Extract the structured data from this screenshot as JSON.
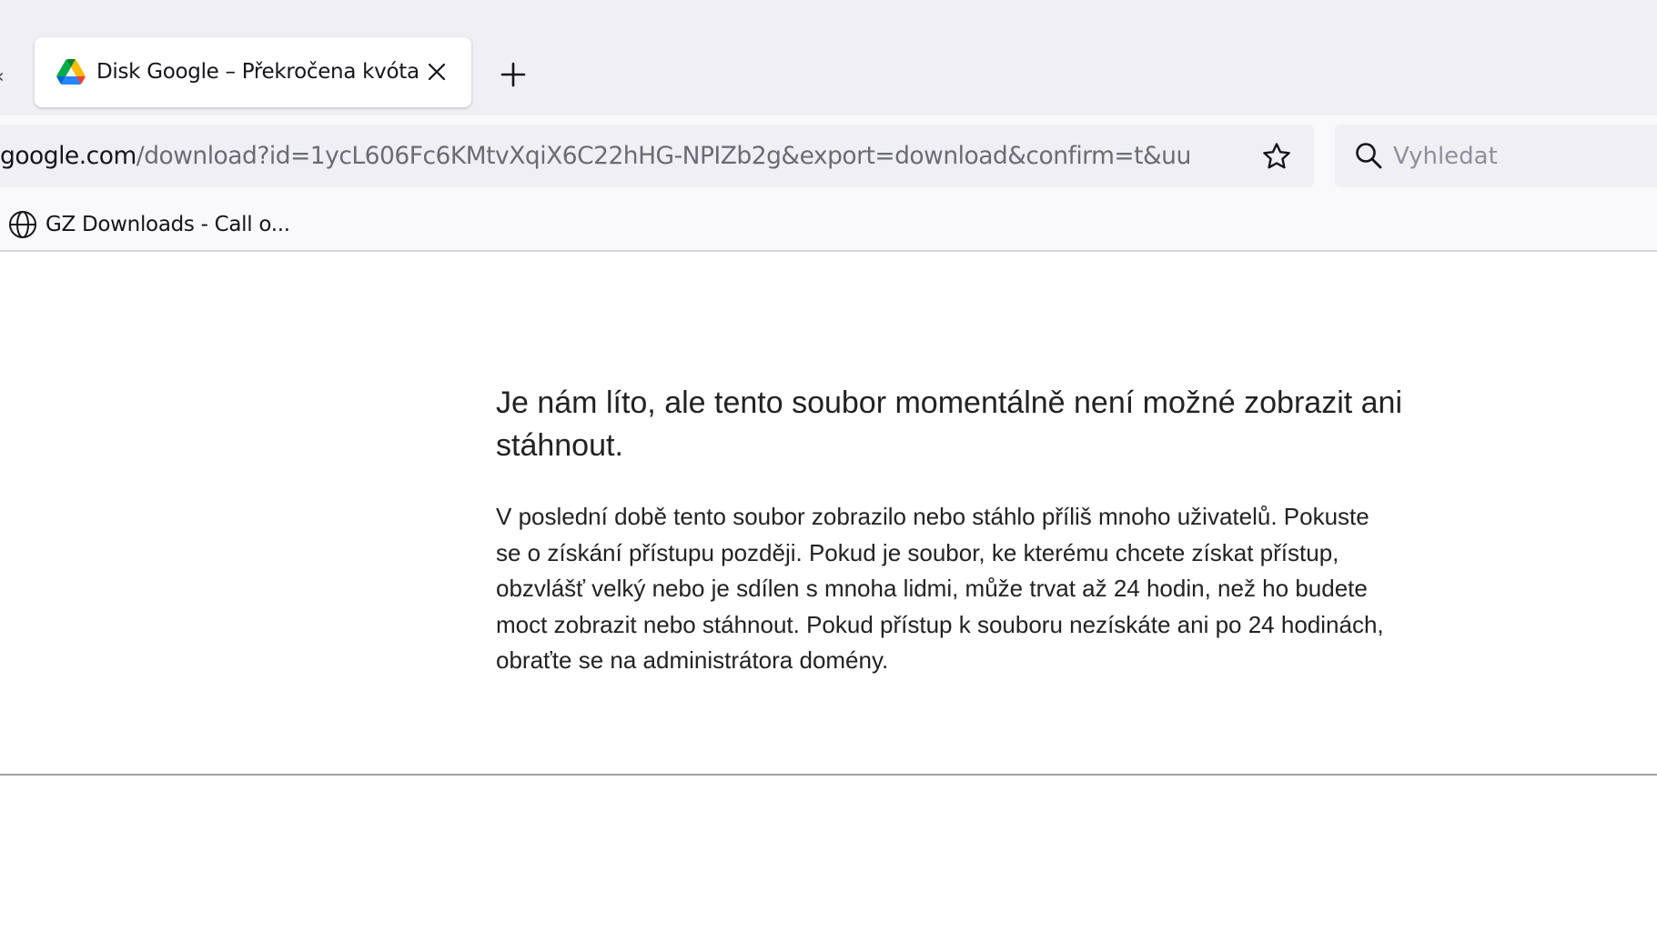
{
  "tab": {
    "title": "Disk Google – Překročena kvóta"
  },
  "address_bar": {
    "domain": "google.com",
    "path": "/download?id=1ycL606Fc6KMtvXqiX6C22hHG-NPIZb2g&export=download&confirm=t&uu"
  },
  "search": {
    "placeholder": "Vyhledat"
  },
  "bookmarks": [
    {
      "label": "GZ Downloads - Call o..."
    }
  ],
  "page": {
    "heading": "Je nám líto, ale tento soubor momentálně není možné zobrazit ani stáhnout.",
    "message": "V poslední době tento soubor zobrazilo nebo stáhlo příliš mnoho uživatelů. Pokuste se o získání přístupu později. Pokud je soubor, ke kterému chcete získat přístup, obzvlášť velký nebo je sdílen s mnoha lidmi, může trvat až 24 hodin, než ho budete moct zobrazit nebo stáhnout. Pokud přístup k souboru nezískáte ani po 24 hodinách, obraťte se na administrátora domény."
  },
  "icons": {
    "tab_favicon": "google-drive-icon",
    "tab_close": "close-icon",
    "new_tab": "plus-icon",
    "bookmark": "star-icon",
    "search": "search-icon",
    "bookmark_favicon": "globe-icon"
  },
  "colors": {
    "drive_green": "#0F9D58",
    "drive_yellow": "#FFC107",
    "drive_blue": "#4285F4"
  }
}
